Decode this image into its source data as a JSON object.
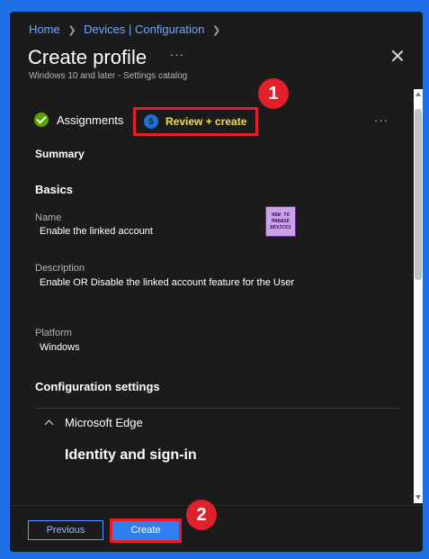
{
  "breadcrumb": [
    {
      "label": "Home"
    },
    {
      "label": "Devices | Configuration"
    }
  ],
  "header": {
    "title": "Create profile",
    "more_label": "···",
    "subtitle": "Windows 10 and later - Settings catalog"
  },
  "steps": [
    {
      "label": "Assignments",
      "status": "complete"
    },
    {
      "number": "5",
      "label": "Review + create",
      "status": "current"
    }
  ],
  "step_more_label": "···",
  "annotations": {
    "badge1": "1",
    "badge2": "2"
  },
  "summary": {
    "heading": "Summary",
    "basics_heading": "Basics",
    "name_label": "Name",
    "name_value": "Enable the linked account",
    "description_label": "Description",
    "description_value": "Enable OR Disable the linked account feature for the User",
    "platform_label": "Platform",
    "platform_value": "Windows",
    "config_heading": "Configuration settings",
    "group_label": "Microsoft Edge",
    "category_title": "Identity and sign-in"
  },
  "logo_text": [
    "HOW TO",
    "MANAGE",
    "DEVICES"
  ],
  "footer": {
    "previous_label": "Previous",
    "create_label": "Create"
  },
  "colors": {
    "background": "#1d6fe6",
    "panel": "#1b1b1b",
    "accent": "#2f7ff0",
    "highlight": "#e51e2a",
    "step_text": "#f7e03c",
    "success": "#57a300"
  }
}
